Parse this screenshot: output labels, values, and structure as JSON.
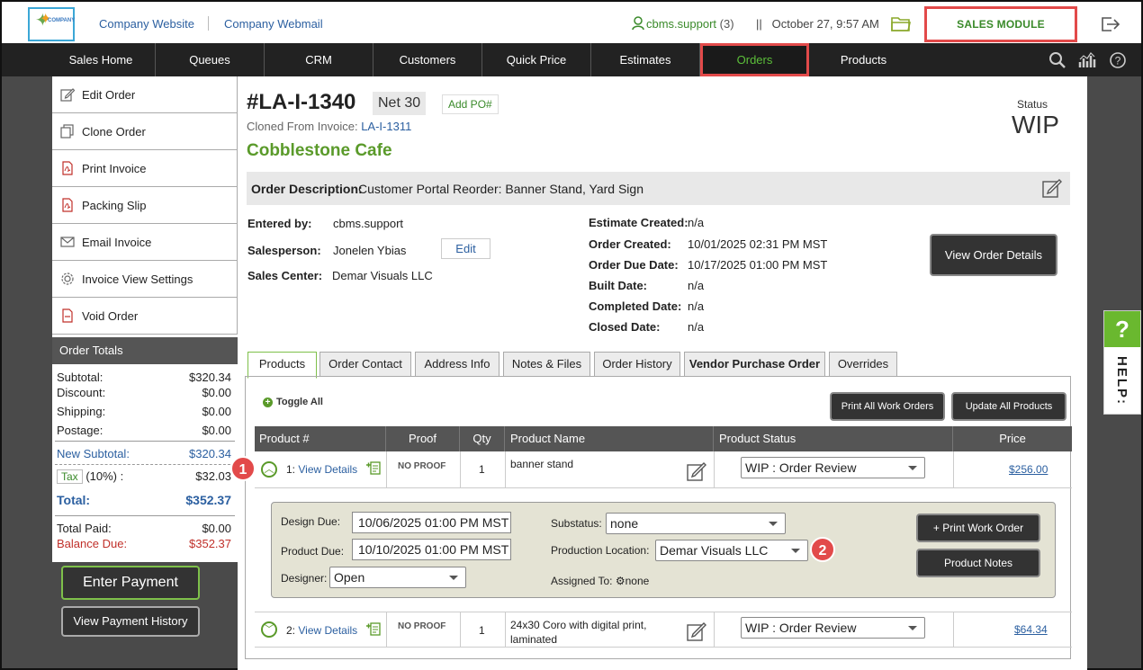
{
  "header": {
    "logo_text": "COMPANY",
    "company_website": "Company Website",
    "company_webmail": "Company Webmail",
    "user_name": "cbms.support",
    "user_count": "(3)",
    "separator": "||",
    "datetime": "October 27, 9:57 AM",
    "sales_module": "SALES MODULE"
  },
  "nav": {
    "items": [
      "Sales Home",
      "Queues",
      "CRM",
      "Customers",
      "Quick Price",
      "Estimates",
      "Orders",
      "Products"
    ],
    "active": "Orders"
  },
  "sidebar": {
    "items": [
      "Edit Order",
      "Clone Order",
      "Print Invoice",
      "Packing Slip",
      "Email Invoice",
      "Invoice View Settings",
      "Void Order"
    ],
    "totals_header": "Order Totals",
    "subtotal_label": "Subtotal:",
    "subtotal": "$320.34",
    "discount_label": "Discount:",
    "discount": "$0.00",
    "shipping_label": "Shipping:",
    "shipping": "$0.00",
    "postage_label": "Postage:",
    "postage": "$0.00",
    "new_subtotal_label": "New Subtotal:",
    "new_subtotal": "$320.34",
    "tax_label": "Tax",
    "tax_rate": "(10%) :",
    "tax": "$32.03",
    "total_label": "Total:",
    "total": "$352.37",
    "total_paid_label": "Total Paid:",
    "total_paid": "$0.00",
    "balance_due_label": "Balance Due:",
    "balance_due": "$352.37",
    "enter_payment": "Enter Payment",
    "view_payment_history": "View Payment History"
  },
  "order": {
    "number": "#LA-I-1340",
    "terms": "Net 30",
    "add_po": "Add PO#",
    "cloned_label": "Cloned From Invoice:",
    "cloned_from": "LA-I-1311",
    "customer": "Cobblestone Cafe",
    "status_label": "Status",
    "status": "WIP",
    "description_label": "Order Description:",
    "description": "Customer Portal Reorder: Banner Stand, Yard Sign",
    "entered_by_label": "Entered by:",
    "entered_by": "cbms.support",
    "salesperson_label": "Salesperson:",
    "salesperson": "Jonelen Ybias",
    "edit": "Edit",
    "sales_center_label": "Sales Center:",
    "sales_center": "Demar Visuals LLC",
    "estimate_created_label": "Estimate Created:",
    "estimate_created": "n/a",
    "order_created_label": "Order Created:",
    "order_created": "10/01/2025 02:31 PM MST",
    "order_due_label": "Order Due Date:",
    "order_due": "10/17/2025 01:00 PM MST",
    "built_label": "Built Date:",
    "built": "n/a",
    "completed_label": "Completed Date:",
    "completed": "n/a",
    "closed_label": "Closed Date:",
    "closed": "n/a",
    "view_details": "View Order Details"
  },
  "tabs": [
    "Products",
    "Order Contact",
    "Address Info",
    "Notes & Files",
    "Order History",
    "Vendor Purchase Order",
    "Overrides"
  ],
  "products": {
    "toggle_all": "Toggle All",
    "print_all": "Print All Work Orders",
    "update_all": "Update All Products",
    "columns": [
      "Product #",
      "Proof",
      "Qty",
      "Product Name",
      "Product Status",
      "Price"
    ],
    "rows": [
      {
        "num": "1:",
        "link": "View Details",
        "proof": "NO PROOF",
        "qty": "1",
        "name": "banner stand",
        "status": "WIP : Order Review",
        "price": "$256.00"
      },
      {
        "num": "2:",
        "link": "View Details",
        "proof": "NO PROOF",
        "qty": "1",
        "name": "24x30 Coro with digital print, laminated",
        "status": "WIP : Order Review",
        "price": "$64.34"
      }
    ],
    "detail": {
      "design_due_label": "Design Due:",
      "design_due": "10/06/2025 01:00 PM MST",
      "product_due_label": "Product Due:",
      "product_due": "10/10/2025 01:00 PM MST",
      "designer_label": "Designer:",
      "designer": "Open",
      "substatus_label": "Substatus:",
      "substatus": "none",
      "location_label": "Production Location:",
      "location": "Demar Visuals LLC",
      "assigned_label": "Assigned To:",
      "assigned": "none",
      "print_work_order": "+ Print Work Order",
      "product_notes": "Product Notes"
    }
  },
  "badges": [
    "1",
    "2"
  ],
  "help": {
    "q": "?",
    "label": "HELP:"
  }
}
